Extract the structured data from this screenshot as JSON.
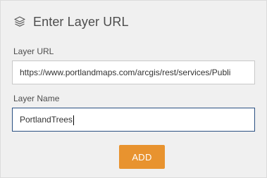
{
  "header": {
    "icon": "layers-icon",
    "title": "Enter Layer URL"
  },
  "form": {
    "url_label": "Layer URL",
    "url_value": "https://www.portlandmaps.com/arcgis/rest/services/Publi",
    "name_label": "Layer Name",
    "name_value": "PortlandTrees"
  },
  "actions": {
    "add_label": "ADD",
    "add_color": "#e8932f"
  },
  "colors": {
    "panel_bg": "#f0f0f0",
    "focus_border": "#2a5082"
  }
}
